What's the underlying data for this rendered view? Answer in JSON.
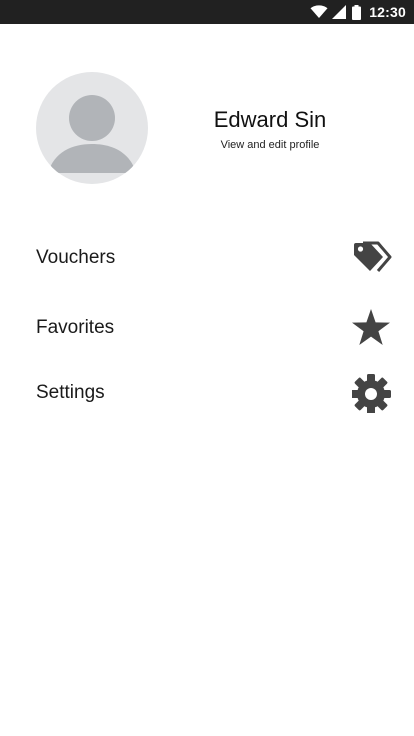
{
  "status_bar": {
    "time": "12:30",
    "icons": [
      "wifi-icon",
      "signal-icon",
      "battery-icon"
    ]
  },
  "profile": {
    "name": "Edward Sin",
    "subtitle": "View and edit profile",
    "avatar_icon": "person-placeholder-icon"
  },
  "menu": {
    "items": [
      {
        "label": "Vouchers",
        "icon": "tags-icon"
      },
      {
        "label": "Favorites",
        "icon": "star-icon"
      },
      {
        "label": "Settings",
        "icon": "gear-icon"
      }
    ]
  },
  "colors": {
    "status_bar_bg": "#212121",
    "icon": "#444444",
    "avatar_bg": "#e4e5e7",
    "avatar_figure": "#b1b4b8"
  }
}
